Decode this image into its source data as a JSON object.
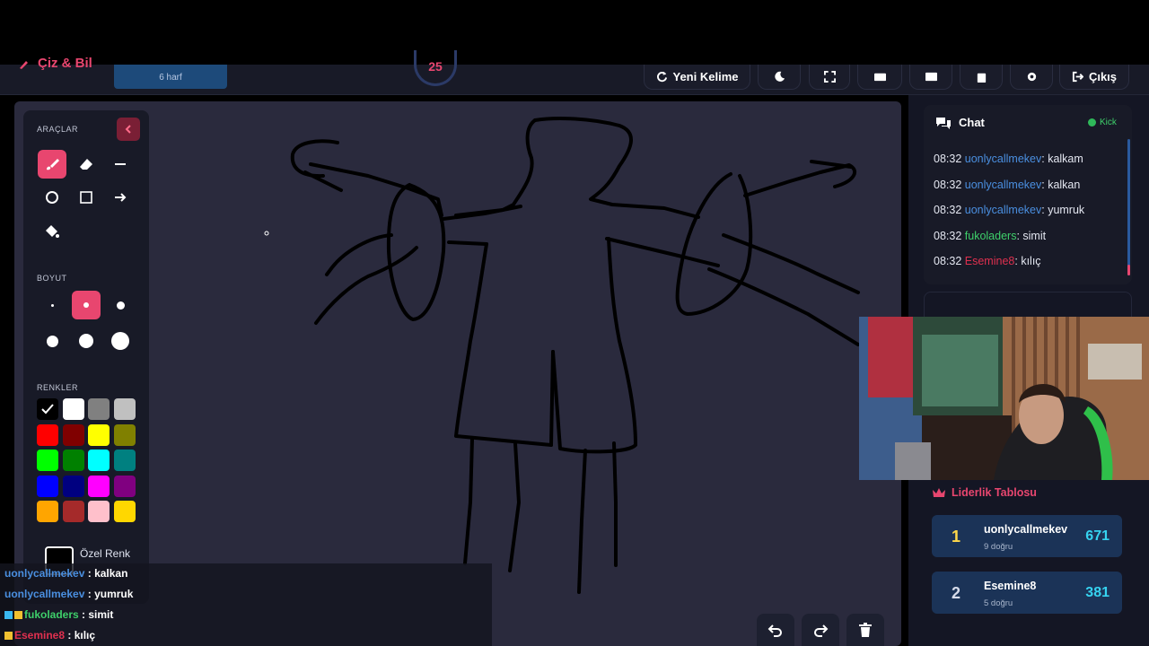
{
  "header": {
    "brand": "Çiz & Bil",
    "word_hint": "6 harf",
    "timer": "25",
    "new_word_label": "Yeni Kelime",
    "exit_label": "Çıkış"
  },
  "tools": {
    "title": "ARAÇLAR",
    "size_title": "BOYUT",
    "colors_title": "RENKLER",
    "custom_color_label": "Özel Renk",
    "colors": [
      "#000000",
      "#ffffff",
      "#808080",
      "#c0c0c0",
      "#ff0000",
      "#800000",
      "#ffff00",
      "#808000",
      "#00ff00",
      "#008000",
      "#00ffff",
      "#008080",
      "#0000ff",
      "#000080",
      "#ff00ff",
      "#800080",
      "#ffa500",
      "#a52a2a",
      "#ffc0cb",
      "#ffd700"
    ],
    "selected_color": "#000000",
    "selected_size_index": 1
  },
  "chat": {
    "title": "Chat",
    "platform": "Kick",
    "messages": [
      {
        "time": "08:32",
        "user": "uonlycallmekev",
        "color": "#4a8fe0",
        "text": "kalkam"
      },
      {
        "time": "08:32",
        "user": "uonlycallmekev",
        "color": "#4a8fe0",
        "text": "kalkan"
      },
      {
        "time": "08:32",
        "user": "uonlycallmekev",
        "color": "#4a8fe0",
        "text": "yumruk"
      },
      {
        "time": "08:32",
        "user": "fukoladers",
        "color": "#3ecf6a",
        "text": "simit"
      },
      {
        "time": "08:32",
        "user": "Esemine8",
        "color": "#e0304f",
        "text": "kılıç"
      }
    ]
  },
  "leaderboard": {
    "title": "Liderlik Tablosu",
    "entries": [
      {
        "rank": "1",
        "rank_color": "#ffd84a",
        "name": "uonlycallmekev",
        "sub": "9 doğru",
        "score": "671"
      },
      {
        "rank": "2",
        "rank_color": "#d7dcea",
        "name": "Esemine8",
        "sub": "5 doğru",
        "score": "381"
      }
    ]
  },
  "overlay_chat": [
    {
      "user": "uonlycallmekev",
      "color": "#4a8fe0",
      "text": "kalkan",
      "badges": []
    },
    {
      "user": "uonlycallmekev",
      "color": "#4a8fe0",
      "text": "yumruk",
      "badges": []
    },
    {
      "user": "fukoladers",
      "color": "#3ecf6a",
      "text": "simit",
      "badges": [
        "#3ab8f0",
        "#f0c030"
      ]
    },
    {
      "user": "Esemine8",
      "color": "#e0304f",
      "text": "kılıç",
      "badges": [
        "#f0c030"
      ]
    }
  ],
  "icons": {
    "brush": "brush-icon",
    "eraser": "eraser-icon",
    "line": "line-icon",
    "circle": "circle-icon",
    "rect": "rectangle-icon",
    "arrow": "arrow-icon",
    "fill": "fill-bucket-icon",
    "undo": "undo-icon",
    "redo": "redo-icon",
    "trash": "trash-icon"
  }
}
